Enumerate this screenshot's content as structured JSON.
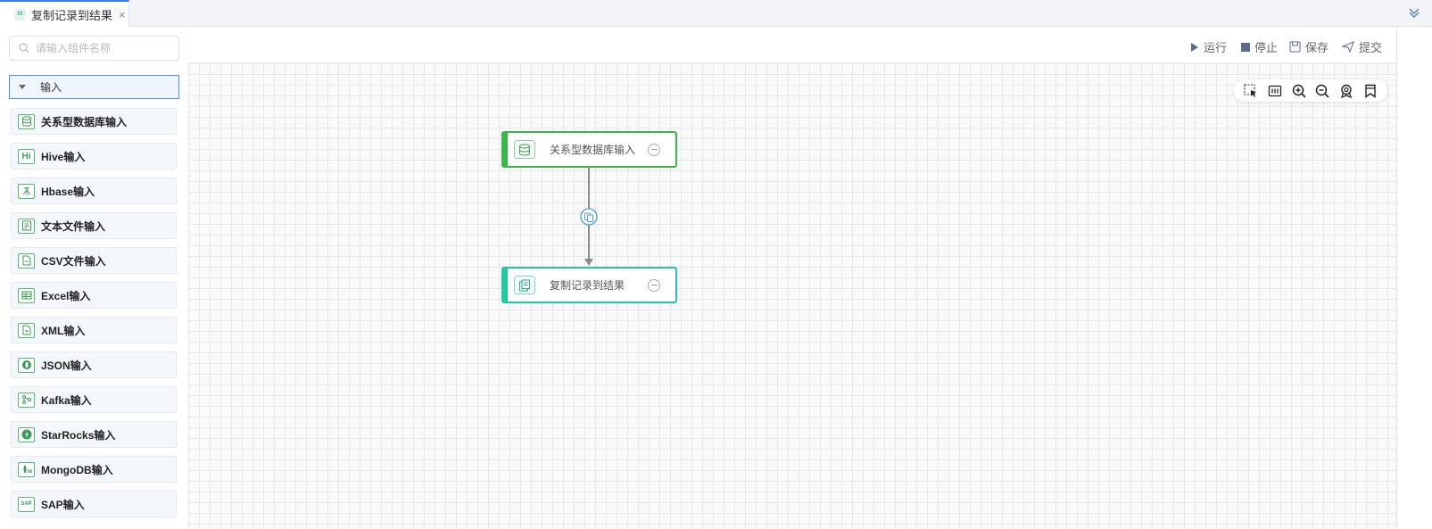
{
  "tab": {
    "title": "复制记录到结果",
    "icon": "DI"
  },
  "sidebar": {
    "search_placeholder": "请输入组件名称",
    "group_label": "输入",
    "items": [
      {
        "label": "关系型数据库输入",
        "icon": "database-icon"
      },
      {
        "label": "Hive输入",
        "icon": "hive-icon",
        "glyph": "Hi"
      },
      {
        "label": "Hbase输入",
        "icon": "hbase-icon"
      },
      {
        "label": "文本文件输入",
        "icon": "text-file-icon"
      },
      {
        "label": "CSV文件输入",
        "icon": "csv-file-icon"
      },
      {
        "label": "Excel输入",
        "icon": "excel-icon"
      },
      {
        "label": "XML输入",
        "icon": "xml-icon"
      },
      {
        "label": "JSON输入",
        "icon": "json-icon"
      },
      {
        "label": "Kafka输入",
        "icon": "kafka-icon"
      },
      {
        "label": "StarRocks输入",
        "icon": "starrocks-icon"
      },
      {
        "label": "MongoDB输入",
        "icon": "mongodb-icon"
      },
      {
        "label": "SAP输入",
        "icon": "sap-icon",
        "glyph": "SAP"
      }
    ]
  },
  "toolbar": {
    "run_label": "运行",
    "stop_label": "停止",
    "save_label": "保存",
    "submit_label": "提交"
  },
  "canvas": {
    "nodes": [
      {
        "label": "关系型数据库输入",
        "icon": "database-icon"
      },
      {
        "label": "复制记录到结果",
        "icon": "copy-records-icon"
      }
    ]
  },
  "colors": {
    "accent_blue": "#3a7bf0",
    "node_green": "#3ab54a",
    "node_teal": "#22c9a0",
    "toolbar_text": "#666666"
  }
}
